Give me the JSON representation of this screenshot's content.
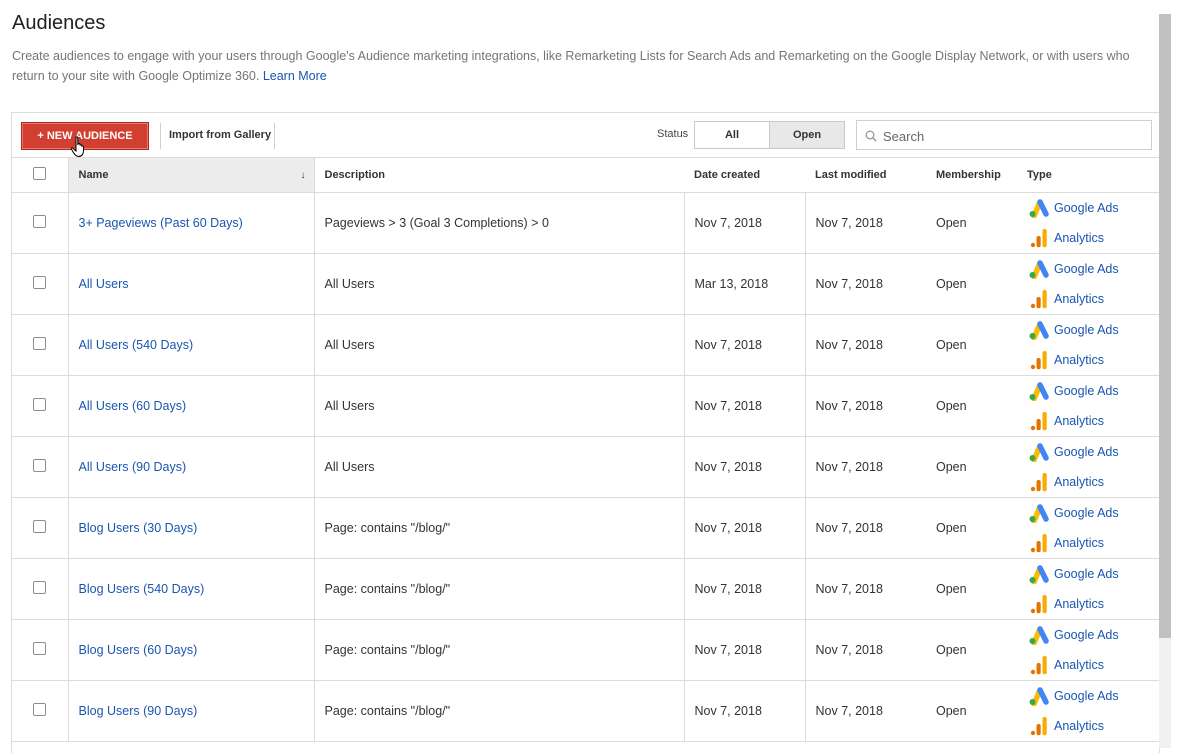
{
  "page": {
    "title": "Audiences",
    "description": "Create audiences to engage with your users through Google's Audience marketing integrations, like Remarketing Lists for Search Ads and Remarketing on the Google Display Network, or with users who return to your site with Google Optimize 360.",
    "learn_more": "Learn More"
  },
  "toolbar": {
    "new_audience": "+ NEW AUDIENCE",
    "import_gallery": "Import from Gallery",
    "status_label": "Status",
    "status_all": "All",
    "status_open": "Open",
    "search_placeholder": "Search"
  },
  "table": {
    "columns": {
      "name": "Name",
      "description": "Description",
      "date_created": "Date created",
      "last_modified": "Last modified",
      "membership": "Membership",
      "type": "Type"
    },
    "rows": [
      {
        "name": "3+ Pageviews (Past 60 Days)",
        "description": "Pageviews > 3 (Goal 3 Completions) > 0",
        "created": "Nov 7, 2018",
        "modified": "Nov 7, 2018",
        "membership": "Open",
        "type1": "Google Ads",
        "type2": "Analytics"
      },
      {
        "name": "All Users",
        "description": "All Users",
        "created": "Mar 13, 2018",
        "modified": "Nov 7, 2018",
        "membership": "Open",
        "type1": "Google Ads",
        "type2": "Analytics"
      },
      {
        "name": "All Users (540 Days)",
        "description": "All Users",
        "created": "Nov 7, 2018",
        "modified": "Nov 7, 2018",
        "membership": "Open",
        "type1": "Google Ads",
        "type2": "Analytics"
      },
      {
        "name": "All Users (60 Days)",
        "description": "All Users",
        "created": "Nov 7, 2018",
        "modified": "Nov 7, 2018",
        "membership": "Open",
        "type1": "Google Ads",
        "type2": "Analytics"
      },
      {
        "name": "All Users (90 Days)",
        "description": "All Users",
        "created": "Nov 7, 2018",
        "modified": "Nov 7, 2018",
        "membership": "Open",
        "type1": "Google Ads",
        "type2": "Analytics"
      },
      {
        "name": "Blog Users (30 Days)",
        "description": "Page: contains \"/blog/\"",
        "created": "Nov 7, 2018",
        "modified": "Nov 7, 2018",
        "membership": "Open",
        "type1": "Google Ads",
        "type2": "Analytics"
      },
      {
        "name": "Blog Users (540 Days)",
        "description": "Page: contains \"/blog/\"",
        "created": "Nov 7, 2018",
        "modified": "Nov 7, 2018",
        "membership": "Open",
        "type1": "Google Ads",
        "type2": "Analytics"
      },
      {
        "name": "Blog Users (60 Days)",
        "description": "Page: contains \"/blog/\"",
        "created": "Nov 7, 2018",
        "modified": "Nov 7, 2018",
        "membership": "Open",
        "type1": "Google Ads",
        "type2": "Analytics"
      },
      {
        "name": "Blog Users (90 Days)",
        "description": "Page: contains \"/blog/\"",
        "created": "Nov 7, 2018",
        "modified": "Nov 7, 2018",
        "membership": "Open",
        "type1": "Google Ads",
        "type2": "Analytics"
      }
    ]
  },
  "colors": {
    "accent_red": "#d23f31",
    "link_blue": "#1a56b0",
    "google_ads_blue": "#4285f4",
    "google_ads_yellow": "#fbbc04",
    "google_ads_green": "#34a853",
    "analytics_orange": "#f9ab00",
    "analytics_dark": "#e37400"
  }
}
